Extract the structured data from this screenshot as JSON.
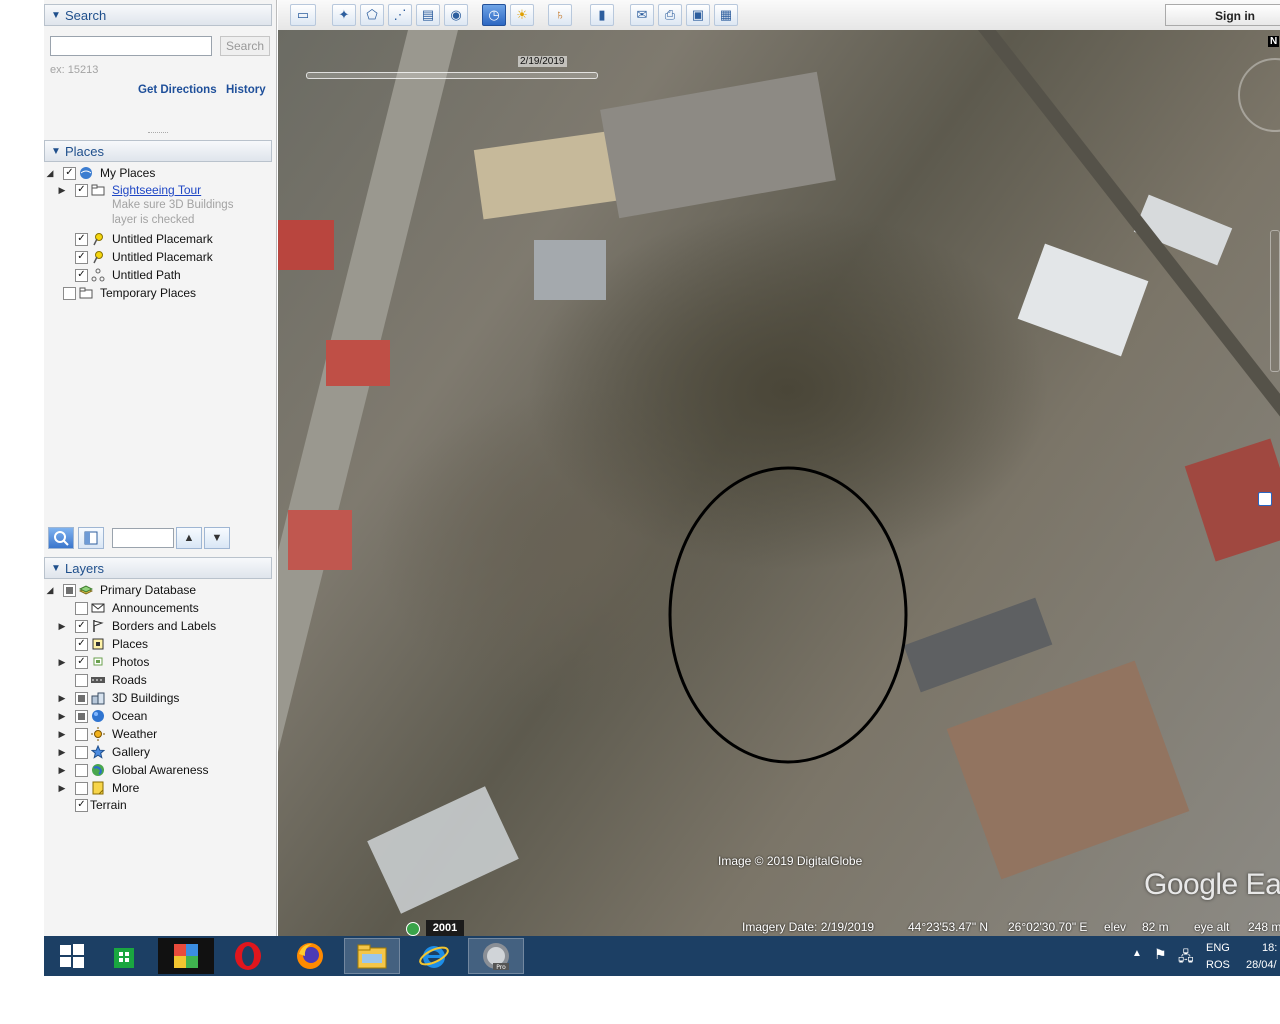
{
  "search": {
    "title": "Search",
    "placeholder": "",
    "button_label": "Search",
    "hint": "ex: 15213",
    "get_directions": "Get Directions",
    "history": "History"
  },
  "places": {
    "title": "Places",
    "items": [
      {
        "label": "My Places",
        "checked": true
      },
      {
        "label": "Sightseeing Tour",
        "checked": true
      },
      {
        "label": "Make sure 3D Buildings",
        "checked": null
      },
      {
        "label": "layer is checked",
        "checked": null
      },
      {
        "label": "Untitled Placemark",
        "checked": true
      },
      {
        "label": "Untitled Placemark",
        "checked": true
      },
      {
        "label": "Untitled Path",
        "checked": true
      },
      {
        "label": "Temporary Places",
        "checked": false
      }
    ]
  },
  "layers": {
    "title": "Layers",
    "items": [
      {
        "label": "Primary Database",
        "state": "partial"
      },
      {
        "label": "Announcements",
        "state": "off"
      },
      {
        "label": "Borders and Labels",
        "state": "on"
      },
      {
        "label": "Places",
        "state": "on"
      },
      {
        "label": "Photos",
        "state": "on"
      },
      {
        "label": "Roads",
        "state": "off"
      },
      {
        "label": "3D Buildings",
        "state": "partial"
      },
      {
        "label": "Ocean",
        "state": "partial"
      },
      {
        "label": "Weather",
        "state": "off"
      },
      {
        "label": "Gallery",
        "state": "off"
      },
      {
        "label": "Global Awareness",
        "state": "off"
      },
      {
        "label": "More",
        "state": "off"
      },
      {
        "label": "Terrain",
        "state": "on"
      }
    ]
  },
  "toolbar": {
    "sign_in": "Sign in"
  },
  "map": {
    "date_label": "2/19/2019",
    "attribution": "Image © 2019 DigitalGlobe",
    "logo": "Google Earth",
    "compass": "N",
    "year_badge": "2001",
    "imagery_date": "Imagery Date: 2/19/2019",
    "lat": "44°23'53.47\" N",
    "lon": "26°02'30.70\" E",
    "elev_label": "elev",
    "elev_value": "82 m",
    "eye_alt_label": "eye alt",
    "eye_alt_value": "248 m"
  },
  "taskbar": {
    "apps": [
      "windows-start",
      "store",
      "colorful-app",
      "opera",
      "firefox",
      "file-explorer",
      "internet-explorer",
      "google-earth-pro"
    ],
    "lang_top": "ENG",
    "lang_bottom": "ROS",
    "time": "18:",
    "date": "28/04/"
  },
  "colors": {
    "panel_header_text": "#1f4f8c",
    "link": "#1e4f9a",
    "taskbar": "#1c3f64"
  }
}
